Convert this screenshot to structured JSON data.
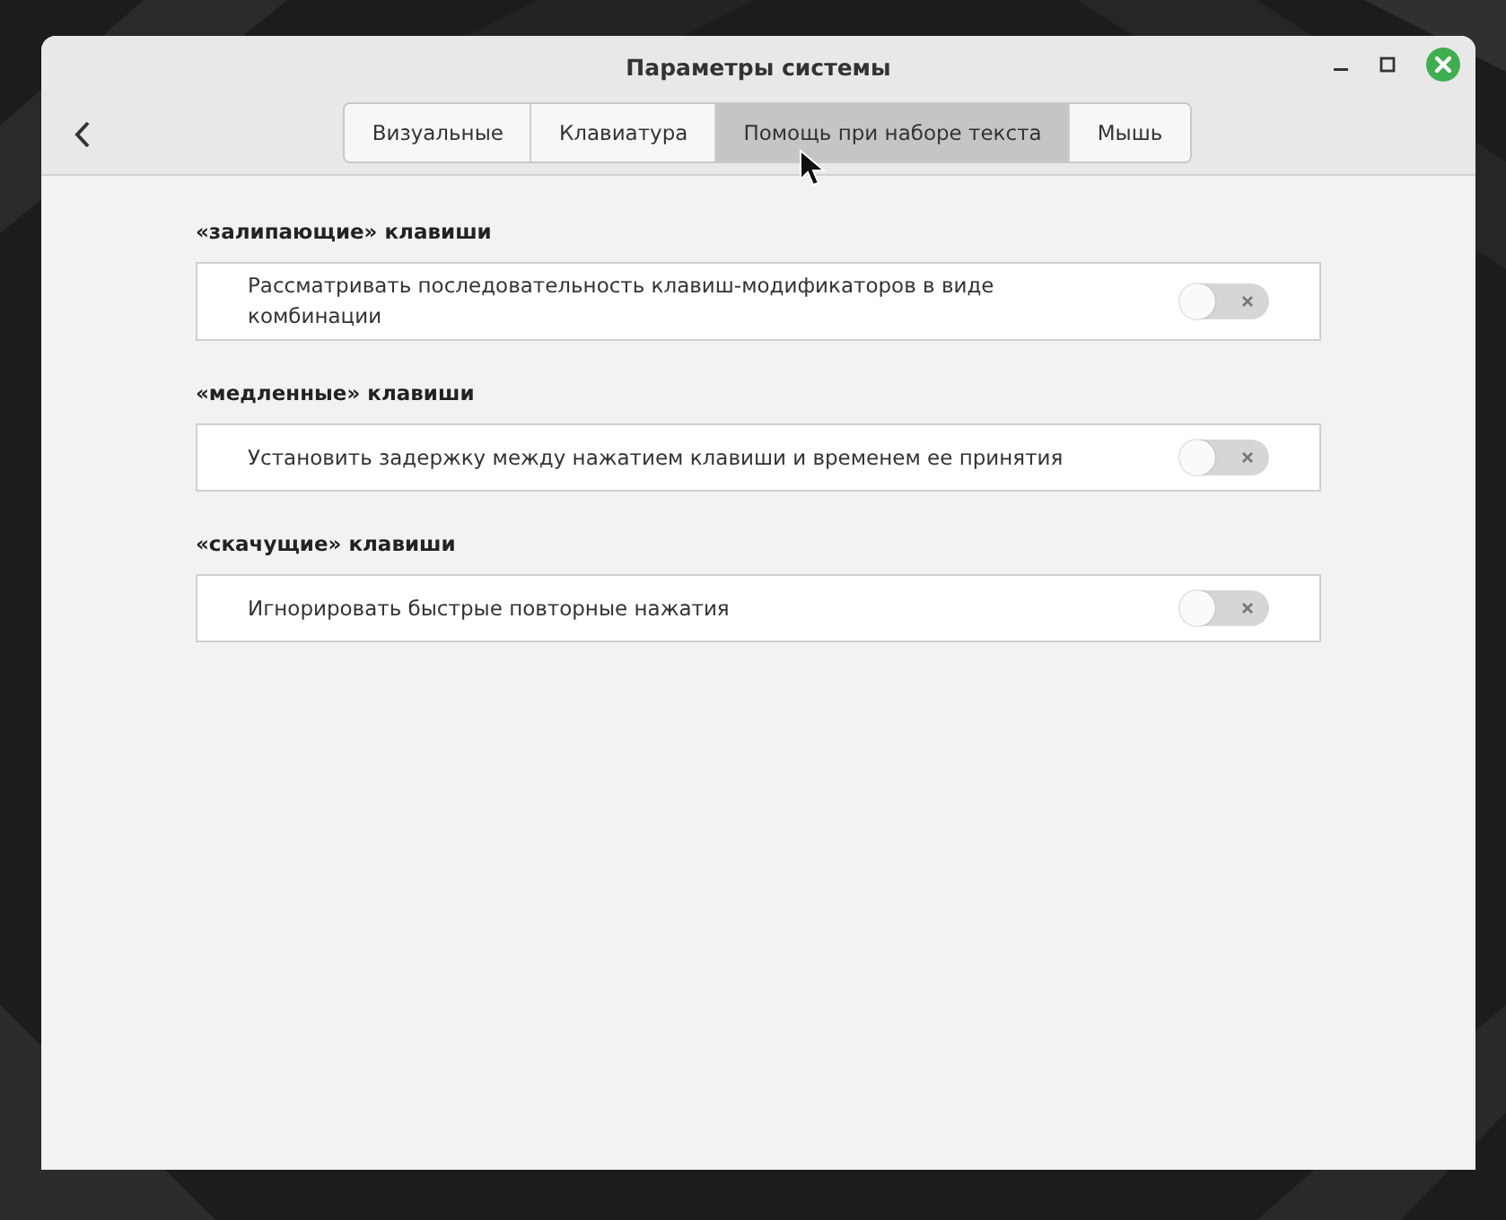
{
  "window": {
    "title": "Параметры системы"
  },
  "tabs": [
    {
      "label": "Визуальные",
      "selected": false
    },
    {
      "label": "Клавиатура",
      "selected": false
    },
    {
      "label": "Помощь при наборе текста",
      "selected": true
    },
    {
      "label": "Мышь",
      "selected": false
    }
  ],
  "sections": [
    {
      "heading": "«залипающие» клавиши",
      "option": "Рассматривать последовательность клавиш-модификаторов в виде комбинации",
      "on": false
    },
    {
      "heading": "«медленные» клавиши",
      "option": "Установить задержку между нажатием клавиши и временем ее принятия",
      "on": false
    },
    {
      "heading": "«скачущие» клавиши",
      "option": "Игнорировать быстрые повторные нажатия",
      "on": false
    }
  ]
}
